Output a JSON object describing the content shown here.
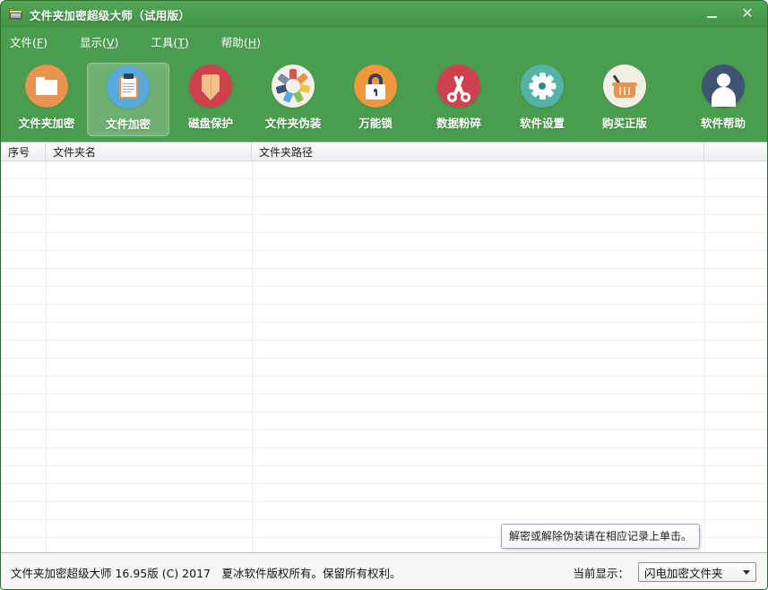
{
  "window": {
    "title": "文件夹加密超级大师（试用版）",
    "app_icon": "folder-lock-icon",
    "accent_green": "#4a9d4e",
    "buttons": [
      {
        "name": "minimize",
        "glyph": "minimize-icon"
      },
      {
        "name": "close",
        "glyph": "close-icon",
        "label": "✕"
      }
    ]
  },
  "menubar": {
    "items": [
      {
        "label": "文件",
        "mnemonic": "F"
      },
      {
        "label": "显示",
        "mnemonic": "V"
      },
      {
        "label": "工具",
        "mnemonic": "T"
      },
      {
        "label": "帮助",
        "mnemonic": "H"
      }
    ]
  },
  "toolbar": {
    "selected_index": 1,
    "buttons": [
      {
        "label": "文件夹加密",
        "icon": "folder-icon",
        "color": "#e8944e"
      },
      {
        "label": "文件加密",
        "icon": "clipboard-icon",
        "color": "#5aa9dd"
      },
      {
        "label": "磁盘保护",
        "icon": "shield-icon",
        "color": "#d0414f"
      },
      {
        "label": "文件夹伪装",
        "icon": "color-wheel-icon",
        "color": "#f4f1ea"
      },
      {
        "label": "万能锁",
        "icon": "padlock-icon",
        "color": "#f0963c"
      },
      {
        "label": "数据粉碎",
        "icon": "scissors-icon",
        "color": "#d0414f"
      },
      {
        "label": "软件设置",
        "icon": "gear-icon",
        "color": "#53b3a6"
      },
      {
        "label": "购买正版",
        "icon": "shopping-basket-icon",
        "color": "#f4efe4"
      },
      {
        "label": "软件帮助",
        "icon": "user-icon",
        "color": "#3f5473"
      }
    ]
  },
  "listview": {
    "columns": [
      {
        "label": "序号"
      },
      {
        "label": "文件夹名"
      },
      {
        "label": "文件夹路径"
      },
      {
        "label": ""
      }
    ],
    "rows": [],
    "row_count_visible": 21
  },
  "tooltip": {
    "text": "解密或解除伪装请在相应记录上单击。"
  },
  "statusbar": {
    "copyright": "文件夹加密超级大师 16.95版 (C) 2017　夏冰软件版权所有。保留所有权利。",
    "display_label": "当前显示：",
    "display_value": "闪电加密文件夹",
    "display_options": [
      "闪电加密文件夹"
    ]
  }
}
